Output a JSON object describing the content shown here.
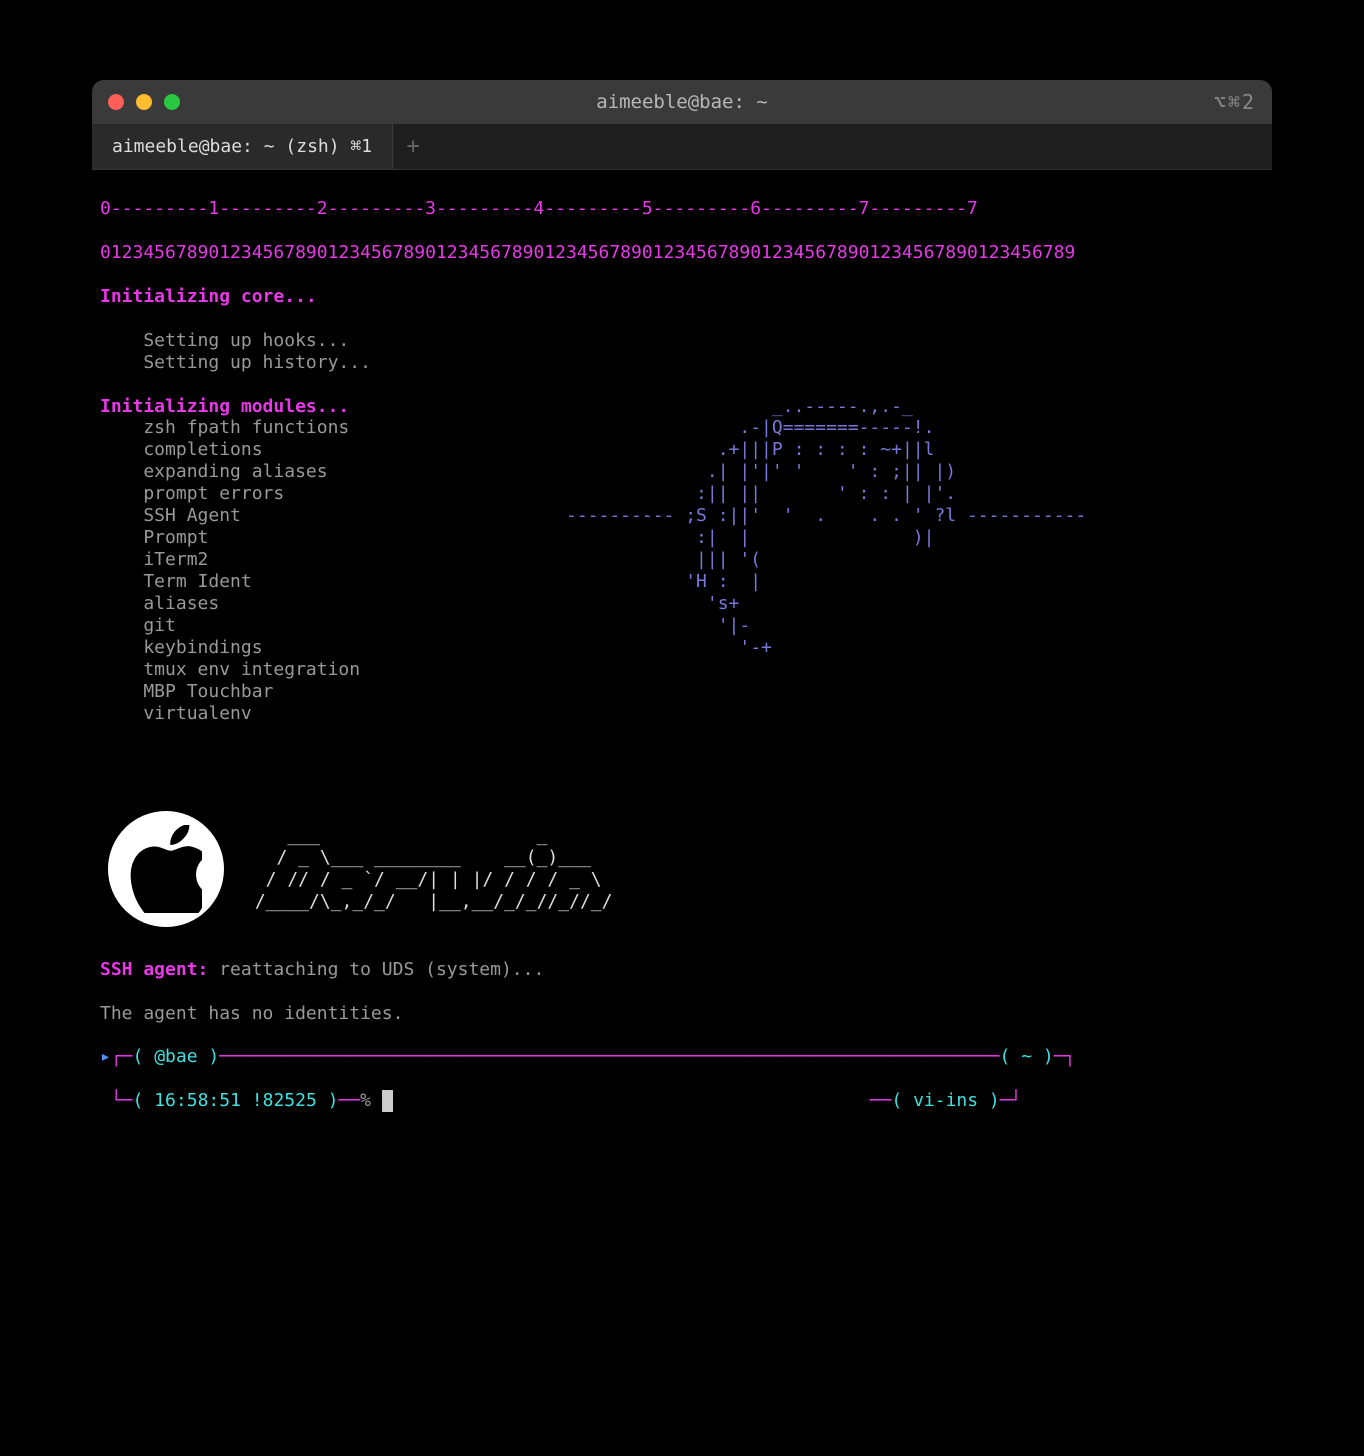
{
  "window": {
    "title": "aimeeble@bae: ~",
    "right_indicator": "⌥⌘2"
  },
  "tab": {
    "label": "aimeeble@bae: ~ (zsh)  ⌘1"
  },
  "ruler": {
    "marks": "0---------1---------2---------3---------4---------5---------6---------7---------7",
    "digits": "012345678901234567890123456789012345678901234567890123456789012345678901234567890123456789"
  },
  "init": {
    "core_header": "Initializing core...",
    "core_lines": [
      "    Setting up hooks...",
      "    Setting up history..."
    ],
    "modules_header": "Initializing modules...",
    "module_items": [
      "zsh fpath functions",
      "completions",
      "expanding aliases",
      "prompt errors",
      "SSH Agent",
      "Prompt",
      "iTerm2",
      "Term Ident",
      "aliases",
      "git",
      "keybindings",
      "tmux env integration",
      "MBP Touchbar",
      "virtualenv"
    ]
  },
  "headphone_art": [
    "                                _..-----.,.-_     ",
    "                             .-|Q=======-----!.   ",
    "                           .+|||P : : : : ~+||l   ",
    "                          .| |'|' '    ' : ;|| |) ",
    "                         :|| ||       ' : : | |'. ",
    "             ---------- ;S :||'  '  .    . . ' ?l -----------",
    "                         :|  |               )|   ",
    "                         ||| '(                   ",
    "                        'H :  |                   ",
    "                          's+                     ",
    "                           '|-                    ",
    "                             '-+                  "
  ],
  "darwin_ascii": [
    "    ___                    _      ",
    "   / _ \\___ ________    __(_)___  ",
    "  / // / _ `/ __/| | |/ / / / _ \\ ",
    " /____/\\_,_/_/   |__,__/_/_//_//_/"
  ],
  "ssh": {
    "label": "SSH agent:",
    "message": " reattaching to UDS (system)...",
    "no_ident": "The agent has no identities."
  },
  "prompt": {
    "host": "@bae",
    "dir": "~",
    "time": "16:58:51",
    "history": "!82525",
    "symbol": "%",
    "mode": "vi-ins"
  }
}
